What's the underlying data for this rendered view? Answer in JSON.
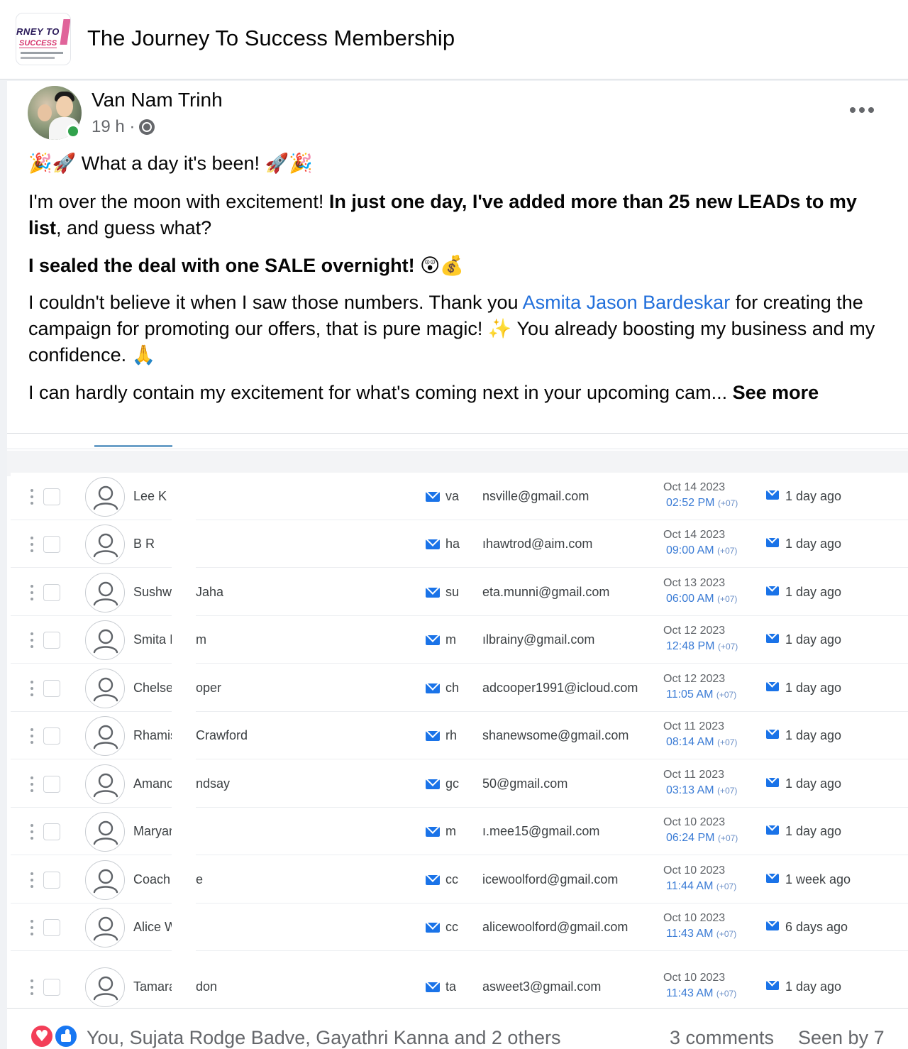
{
  "group": {
    "title": "The Journey To Success Membership",
    "logo_text_1": "RNEY TO",
    "logo_text_2": "SUCCESS"
  },
  "post": {
    "author": "Van Nam Trinh",
    "time": "19 h ·",
    "line1_emoji_left": "🎉🚀",
    "line1_text": " What a day it's been! ",
    "line1_emoji_right": "🚀🎉",
    "p2_a": "I'm over the moon with excitement! ",
    "p2_b": "In just one day, I've added more than 25 new LEADs to my list",
    "p2_c": ", and guess what?",
    "p3_bold": "I sealed the deal with one SALE overnight! ",
    "p3_emoji": "😲💰",
    "p4_a": "I couldn't believe it when I saw those numbers. Thank you ",
    "p4_mention": "Asmita Jason Bardeskar",
    "p4_b": " for creating the campaign for promoting our offers, that is pure magic! ",
    "p4_emoji1": "✨",
    "p4_c": " You already boosting my business and my confidence. ",
    "p4_emoji2": "🙏",
    "p5_text": "I can hardly contain my excitement for what's coming next in your upcoming cam... ",
    "see_more": "See more"
  },
  "contacts": [
    {
      "first": "Lee K",
      "last": "",
      "email_prefix": "va",
      "email": "nsville@gmail.com",
      "date": "Oct 14 2023",
      "time": "02:52 PM",
      "tz": "(+07)",
      "activity": "1 day ago"
    },
    {
      "first": "B R",
      "last": "",
      "email_prefix": "ha",
      "email": "ıhawtrod@aim.com",
      "date": "Oct 14 2023",
      "time": "09:00 AM",
      "tz": "(+07)",
      "activity": "1 day ago"
    },
    {
      "first": "Sushw",
      "last": "Jaha",
      "email_prefix": "su",
      "email": "eta.munni@gmail.com",
      "date": "Oct 13 2023",
      "time": "06:00 AM",
      "tz": "(+07)",
      "activity": "1 day ago"
    },
    {
      "first": "Smita I",
      "last": "m",
      "email_prefix": "m",
      "email": "ılbrainy@gmail.com",
      "date": "Oct 12 2023",
      "time": "12:48 PM",
      "tz": "(+07)",
      "activity": "1 day ago"
    },
    {
      "first": "Chelse",
      "last": "oper",
      "email_prefix": "ch",
      "email": "adcooper1991@icloud.com",
      "date": "Oct 12 2023",
      "time": "11:05 AM",
      "tz": "(+07)",
      "activity": "1 day ago"
    },
    {
      "first": "Rhamis",
      "last": "Crawford",
      "email_prefix": "rh",
      "email": "shanewsome@gmail.com",
      "date": "Oct 11 2023",
      "time": "08:14 AM",
      "tz": "(+07)",
      "activity": "1 day ago"
    },
    {
      "first": "Amanc",
      "last": "ndsay",
      "email_prefix": "gc",
      "email": "50@gmail.com",
      "date": "Oct 11 2023",
      "time": "03:13 AM",
      "tz": "(+07)",
      "activity": "1 day ago"
    },
    {
      "first": "Maryar",
      "last": "",
      "email_prefix": "m",
      "email": "ı.mee15@gmail.com",
      "date": "Oct 10 2023",
      "time": "06:24 PM",
      "tz": "(+07)",
      "activity": "1 day ago"
    },
    {
      "first": "Coach",
      "last": "e",
      "email_prefix": "cc",
      "email": "icewoolford@gmail.com",
      "date": "Oct 10 2023",
      "time": "11:44 AM",
      "tz": "(+07)",
      "activity": "1 week ago"
    },
    {
      "first": "Alice W",
      "last": "",
      "email_prefix": "cc",
      "email": "alicewoolford@gmail.com",
      "date": "Oct 10 2023",
      "time": "11:43 AM",
      "tz": "(+07)",
      "activity": "6 days ago"
    },
    {
      "first": "Tamara",
      "last": "don",
      "email_prefix": "ta",
      "email": "asweet3@gmail.com",
      "date": "Oct 10 2023",
      "time": "11:43 AM",
      "tz": "(+07)",
      "activity": "1 day ago"
    }
  ],
  "footer": {
    "reactions": "You, Sujata Rodge Badve, Gayathri Kanna and 2 others",
    "comments": "3 comments",
    "seen_by": "Seen by 7"
  },
  "colors": {
    "link": "#216fdb",
    "online": "#31a24c",
    "love": "#f33e58",
    "like": "#1877f2",
    "mail": "#1a73e8"
  },
  "icons": [
    "globe-icon",
    "more-options-icon",
    "mail-icon",
    "user-icon",
    "drag-handle-icon",
    "love-reaction-icon",
    "like-reaction-icon"
  ]
}
